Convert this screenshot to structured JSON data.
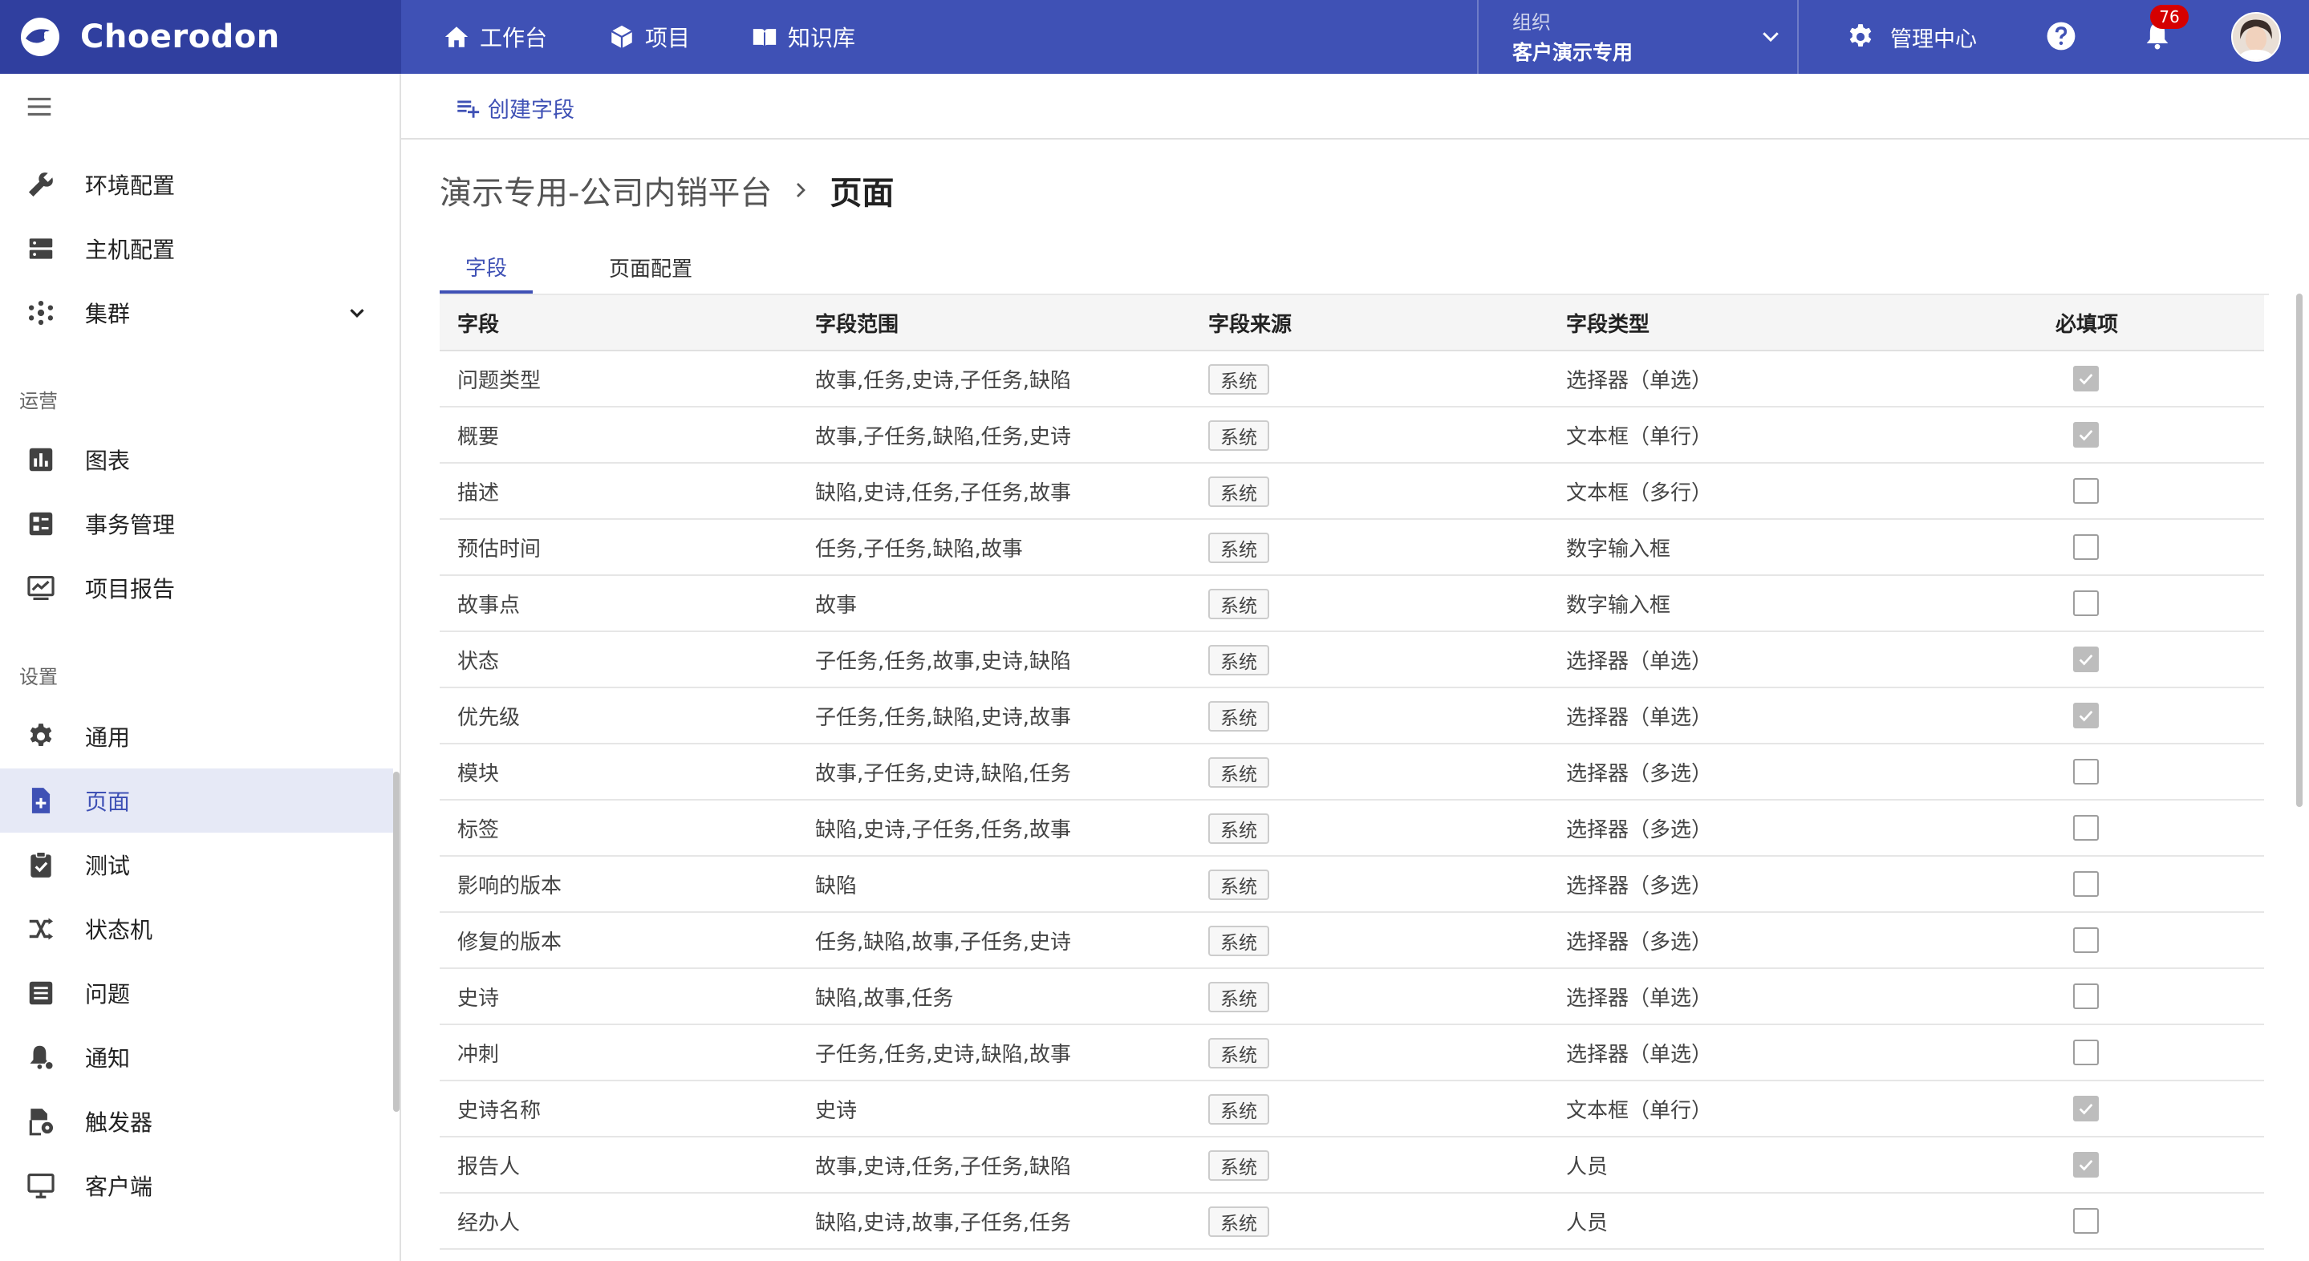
{
  "header": {
    "brand": "Choerodon",
    "nav": [
      {
        "label": "工作台",
        "icon": "home-icon"
      },
      {
        "label": "项目",
        "icon": "cube-icon"
      },
      {
        "label": "知识库",
        "icon": "book-icon"
      }
    ],
    "org_label": "组织",
    "org_value": "客户演示专用",
    "management_label": "管理中心",
    "notification_count": "76",
    "colors": {
      "header_bg": "#3f51b5",
      "brand_bg": "#303f9f",
      "badge": "#d50000"
    }
  },
  "sidebar": {
    "top_items": [
      {
        "label": "环境配置",
        "icon": "wrench-icon"
      },
      {
        "label": "主机配置",
        "icon": "server-icon"
      },
      {
        "label": "集群",
        "icon": "cluster-icon"
      }
    ],
    "section_ops": "运营",
    "ops_items": [
      {
        "label": "图表",
        "icon": "bar-chart-icon"
      },
      {
        "label": "事务管理",
        "icon": "transactions-icon"
      },
      {
        "label": "项目报告",
        "icon": "report-icon"
      }
    ],
    "section_settings": "设置",
    "settings_items": [
      {
        "label": "通用",
        "icon": "gear-icon"
      },
      {
        "label": "页面",
        "icon": "page-add-icon",
        "active": true
      },
      {
        "label": "测试",
        "icon": "clipboard-check-icon"
      },
      {
        "label": "状态机",
        "icon": "shuffle-icon"
      },
      {
        "label": "问题",
        "icon": "list-icon"
      },
      {
        "label": "通知",
        "icon": "notification-settings-icon"
      },
      {
        "label": "触发器",
        "icon": "trigger-icon"
      },
      {
        "label": "客户端",
        "icon": "monitor-icon"
      }
    ]
  },
  "toolbar": {
    "create_label": "创建字段"
  },
  "breadcrumb": {
    "parent": "演示专用-公司内销平台",
    "current": "页面"
  },
  "tabs": [
    {
      "label": "字段",
      "active": true
    },
    {
      "label": "页面配置"
    }
  ],
  "table": {
    "headers": [
      "字段",
      "字段范围",
      "字段来源",
      "字段类型",
      "必填项"
    ],
    "rows": [
      {
        "name": "问题类型",
        "scope": "故事,任务,史诗,子任务,缺陷",
        "source": "系统",
        "type": "选择器（单选）",
        "required": true
      },
      {
        "name": "概要",
        "scope": "故事,子任务,缺陷,任务,史诗",
        "source": "系统",
        "type": "文本框（单行）",
        "required": true
      },
      {
        "name": "描述",
        "scope": "缺陷,史诗,任务,子任务,故事",
        "source": "系统",
        "type": "文本框（多行）",
        "required": false
      },
      {
        "name": "预估时间",
        "scope": "任务,子任务,缺陷,故事",
        "source": "系统",
        "type": "数字输入框",
        "required": false
      },
      {
        "name": "故事点",
        "scope": "故事",
        "source": "系统",
        "type": "数字输入框",
        "required": false
      },
      {
        "name": "状态",
        "scope": "子任务,任务,故事,史诗,缺陷",
        "source": "系统",
        "type": "选择器（单选）",
        "required": true
      },
      {
        "name": "优先级",
        "scope": "子任务,任务,缺陷,史诗,故事",
        "source": "系统",
        "type": "选择器（单选）",
        "required": true
      },
      {
        "name": "模块",
        "scope": "故事,子任务,史诗,缺陷,任务",
        "source": "系统",
        "type": "选择器（多选）",
        "required": false
      },
      {
        "name": "标签",
        "scope": "缺陷,史诗,子任务,任务,故事",
        "source": "系统",
        "type": "选择器（多选）",
        "required": false
      },
      {
        "name": "影响的版本",
        "scope": "缺陷",
        "source": "系统",
        "type": "选择器（多选）",
        "required": false
      },
      {
        "name": "修复的版本",
        "scope": "任务,缺陷,故事,子任务,史诗",
        "source": "系统",
        "type": "选择器（多选）",
        "required": false
      },
      {
        "name": "史诗",
        "scope": "缺陷,故事,任务",
        "source": "系统",
        "type": "选择器（单选）",
        "required": false
      },
      {
        "name": "冲刺",
        "scope": "子任务,任务,史诗,缺陷,故事",
        "source": "系统",
        "type": "选择器（单选）",
        "required": false
      },
      {
        "name": "史诗名称",
        "scope": "史诗",
        "source": "系统",
        "type": "文本框（单行）",
        "required": true
      },
      {
        "name": "报告人",
        "scope": "故事,史诗,任务,子任务,缺陷",
        "source": "系统",
        "type": "人员",
        "required": true
      },
      {
        "name": "经办人",
        "scope": "缺陷,史诗,故事,子任务,任务",
        "source": "系统",
        "type": "人员",
        "required": false
      }
    ]
  }
}
